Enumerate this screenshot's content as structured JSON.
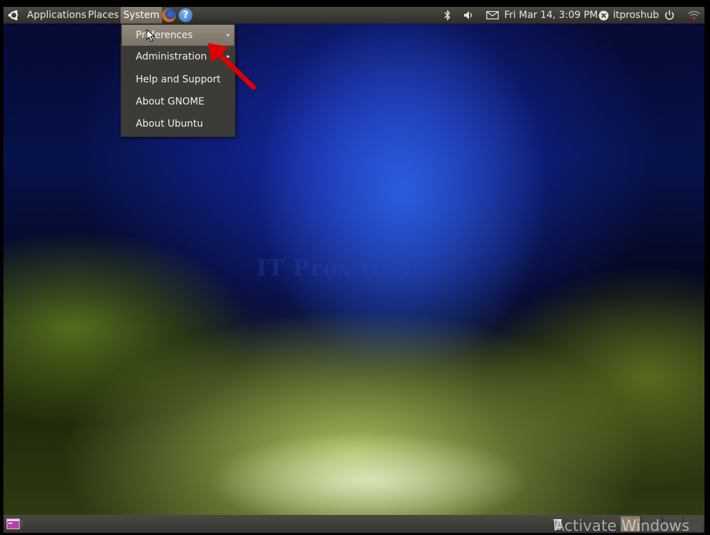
{
  "top_panel": {
    "menus": {
      "applications": "Applications",
      "places": "Places",
      "system": "System"
    },
    "clock": "Fri Mar 14,  3:09 PM",
    "user": "itproshub",
    "launchers": [
      "firefox-icon",
      "help-icon"
    ],
    "tray_icons": [
      "bluetooth-icon",
      "volume-icon",
      "mail-icon",
      "user-status-icon",
      "power-icon",
      "network-icon"
    ]
  },
  "system_menu": {
    "items": [
      {
        "label": "Preferences",
        "submenu": true,
        "highlighted": true
      },
      {
        "label": "Administration",
        "submenu": true,
        "highlighted": false
      },
      {
        "label": "Help and Support",
        "submenu": false,
        "highlighted": false
      },
      {
        "label": "About GNOME",
        "submenu": false,
        "highlighted": false
      },
      {
        "label": "About Ubuntu",
        "submenu": false,
        "highlighted": false
      }
    ],
    "submenu_arrow": "▸"
  },
  "help_glyph": "?",
  "wallpaper_watermark": "IT Pros HUB",
  "activate_windows": "Activate Windows",
  "colors": {
    "panel": "#3b3a35",
    "menu_bg": "#3c3b37",
    "menu_highlight": "#948b7f",
    "annotation_arrow": "#e00000"
  }
}
